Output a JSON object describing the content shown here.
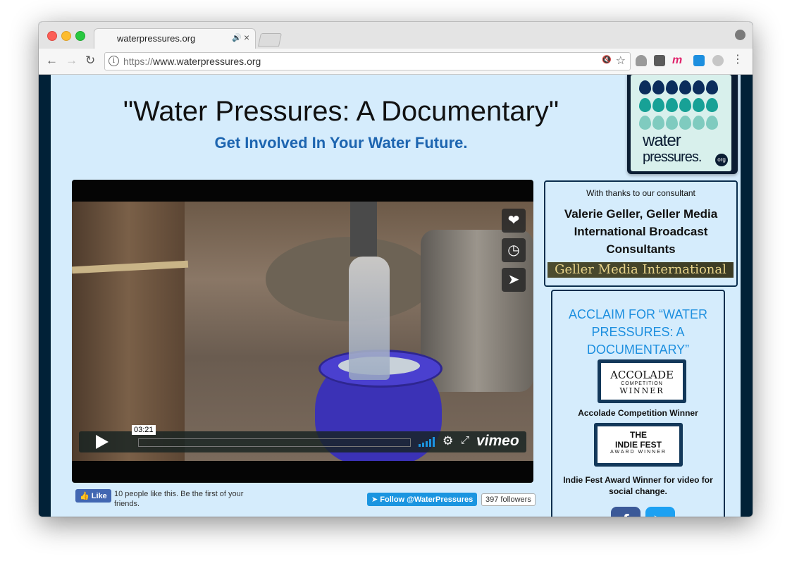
{
  "browser": {
    "tab_title": "waterpressures.org",
    "tab_audio_icon": "speaker-icon",
    "url_scheme": "https://",
    "url_host": "www.waterpressures.org"
  },
  "page": {
    "title": "\"Water Pressures: A Documentary\"",
    "subtitle": "Get Involved In Your Water Future."
  },
  "video": {
    "timecode": "03:21",
    "brand": "vimeo",
    "side_buttons": [
      "heart-icon",
      "clock-icon",
      "send-icon"
    ]
  },
  "social_bar": {
    "fb_like_label": "Like",
    "fb_like_text": "10 people like this. Be the first of your friends.",
    "twitter_follow_label": "Follow @WaterPressures",
    "twitter_followers": "397 followers"
  },
  "logo": {
    "word1": "water",
    "word2": "pressures.",
    "org": "org"
  },
  "consultant": {
    "thanks": "With thanks to our consultant",
    "name": "Valerie Geller, Geller Media International Broadcast Consultants",
    "banner": "Geller Media International"
  },
  "acclaim": {
    "heading": "ACCLAIM FOR “WATER PRESSURES: A DOCUMENTARY”",
    "award1": {
      "l1": "ACCOLADE",
      "l2": "COMPETITION",
      "l3": "WINNER",
      "caption": "Accolade Competition Winner"
    },
    "award2": {
      "l1": "THE",
      "l2": "INDIE FEST",
      "l3": "AWARD WINNER",
      "caption": "Indie Fest Award Winner for video for social change."
    }
  },
  "colors": {
    "page_bg": "#d5ecfc",
    "frame_dark": "#012137",
    "subtitle_blue": "#1d65b0",
    "acclaim_blue": "#1d8fdf"
  }
}
